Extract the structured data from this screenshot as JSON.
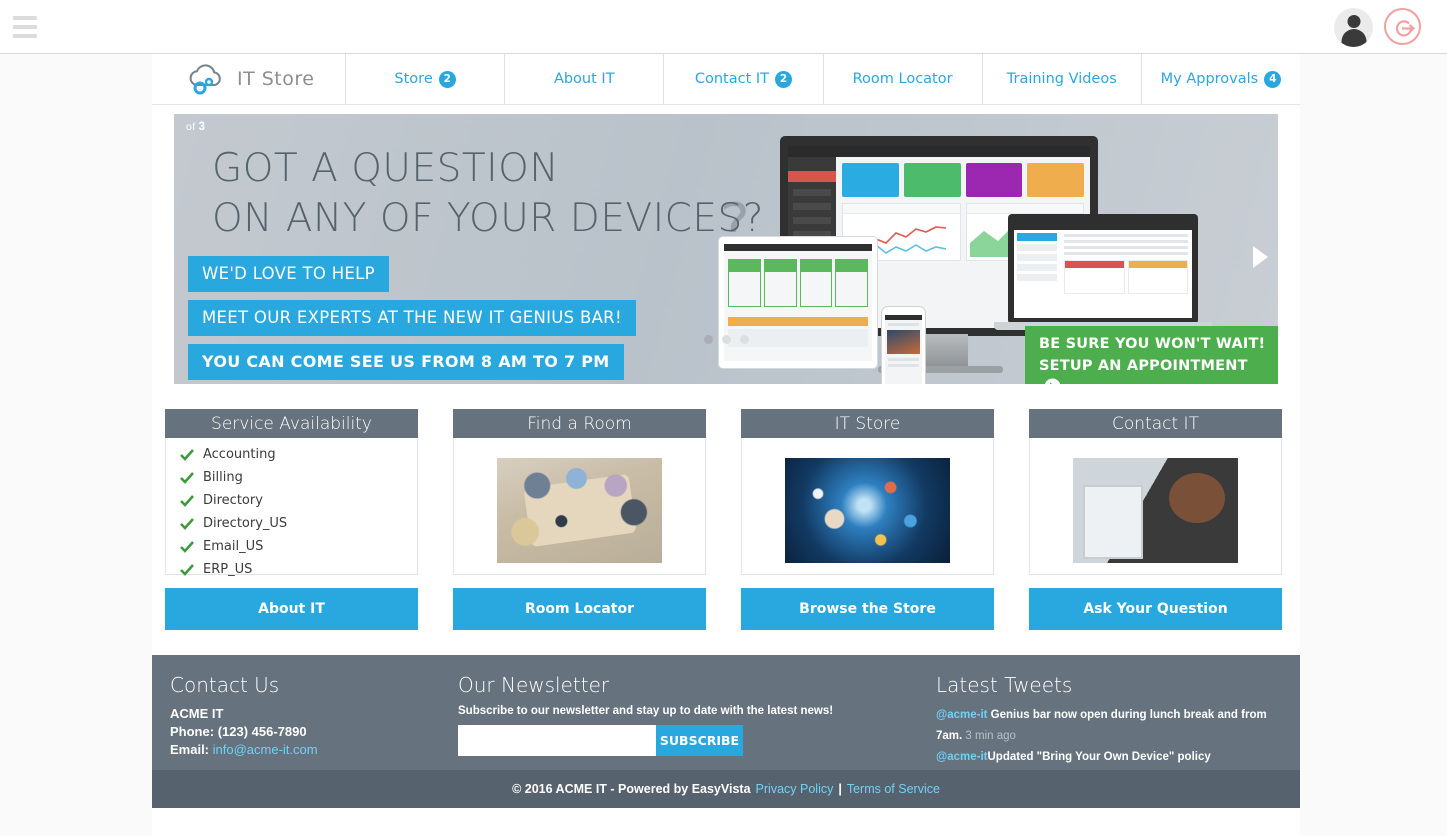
{
  "topbar": {
    "menu_icon": "hamburger-icon",
    "avatar_icon": "user-avatar-icon",
    "logout_icon": "power-logout-icon"
  },
  "nav": {
    "brand": {
      "logo_icon": "cloud-gear-icon",
      "text": "IT Store"
    },
    "items": [
      {
        "label": "Store",
        "badge": "2"
      },
      {
        "label": "About IT",
        "badge": ""
      },
      {
        "label": "Contact IT",
        "badge": "2"
      },
      {
        "label": "Room Locator",
        "badge": ""
      },
      {
        "label": "Training Videos",
        "badge": ""
      },
      {
        "label": "My Approvals",
        "badge": "4"
      }
    ]
  },
  "hero": {
    "counter_prefix": "of",
    "counter_total": "3",
    "title": "GOT A QUESTION\nON ANY OF YOUR DEVICES?",
    "tags": [
      "WE'D LOVE TO HELP",
      "MEET OUR EXPERTS AT THE NEW IT GENIUS BAR!",
      "YOU CAN COME SEE US FROM 8 AM TO 7 PM"
    ],
    "cta_line1": "BE SURE YOU WON'T WAIT!",
    "cta_line2": "SETUP AN APPOINTMENT",
    "cta_arrow_icon": "arrow-circle-right-icon",
    "next_arrow_icon": "chevron-right-icon",
    "dots": [
      "active",
      "inactive",
      "inactive"
    ]
  },
  "cards": [
    {
      "title": "Service Availability",
      "type": "list",
      "items": [
        "Accounting",
        "Billing",
        "Directory",
        "Directory_US",
        "Email_US",
        "ERP_US"
      ],
      "status_icon": "green-check-icon",
      "cta": "About IT"
    },
    {
      "title": "Find a Room",
      "type": "image",
      "image_name": "meeting-room-photo",
      "cta": "Room Locator"
    },
    {
      "title": "IT Store",
      "type": "image",
      "image_name": "digital-store-photo",
      "cta": "Browse the Store"
    },
    {
      "title": "Contact IT",
      "type": "image",
      "image_name": "support-agent-photo",
      "cta": "Ask Your Question"
    }
  ],
  "footer": {
    "contact": {
      "title": "Contact Us",
      "company": "ACME IT",
      "phone_label": "Phone:",
      "phone": "(123) 456-7890",
      "email_label": "Email:",
      "email": "info@acme-it.com"
    },
    "newsletter": {
      "title": "Our Newsletter",
      "subtitle": "Subscribe to our newsletter and stay up to date with the latest news!",
      "input_value": "",
      "input_placeholder": "",
      "button": "SUBSCRIBE"
    },
    "tweets": {
      "title": "Latest Tweets",
      "items": [
        {
          "handle": "@acme-it",
          "text": " Genius bar now open during lunch break and from 7am.",
          "time": " 3 min ago"
        },
        {
          "handle": "@acme-it",
          "text": "Updated \"Bring Your Own Device\" policy",
          "time": ""
        }
      ]
    },
    "copyright": {
      "text": "© 2016 ACME IT - Powered by EasyVista",
      "privacy": "Privacy Policy",
      "divider": "|",
      "terms": "Terms of Service"
    }
  },
  "colors": {
    "accent_blue": "#29a8e0",
    "slate": "#66727e",
    "green": "#4cae4c",
    "link_blue": "#6fd2f5"
  }
}
